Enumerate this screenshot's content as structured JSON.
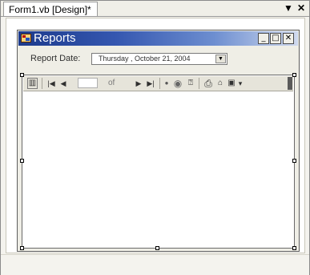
{
  "tab": {
    "title": "Form1.vb [Design]*",
    "menu_glyph": "▼",
    "close_glyph": "✕"
  },
  "form": {
    "title": "Reports",
    "minimize_glyph": "_",
    "maximize_glyph": "□",
    "close_glyph": "✕"
  },
  "report_date": {
    "label": "Report Date:",
    "value": "Thursday , October 21, 2004",
    "dropdown_glyph": "▼"
  },
  "viewer_toolbar": {
    "export_glyph": "▥",
    "first_glyph": "|◀",
    "prev_glyph": "◀",
    "of_label": "of",
    "next_glyph": "▶",
    "last_glyph": "▶|",
    "stop_glyph": "●",
    "refresh_glyph": "◉",
    "help_glyph": "⍰",
    "print_glyph": "⎙",
    "layout_glyph": "⌂",
    "save_glyph": "▣",
    "save_dropdown_glyph": "▾"
  }
}
